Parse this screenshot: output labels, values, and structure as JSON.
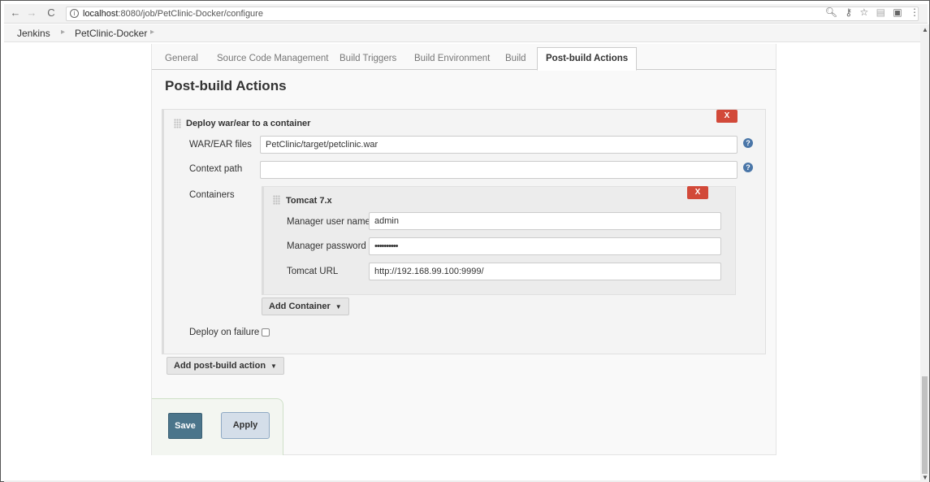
{
  "browser": {
    "back_glyph": "←",
    "forward_glyph": "→",
    "reload_glyph": "C",
    "url_host": "localhost",
    "url_rest": ":8080/job/PetClinic-Docker/configure",
    "toolbar_icons": [
      "zoom-icon",
      "key-icon",
      "star-icon",
      "pdf-icon",
      "extension-icon",
      "menu-icon"
    ]
  },
  "breadcrumb": {
    "items": [
      "Jenkins",
      "PetClinic-Docker"
    ]
  },
  "tabs": [
    {
      "label": "General"
    },
    {
      "label": "Source Code Management"
    },
    {
      "label": "Build Triggers"
    },
    {
      "label": "Build Environment"
    },
    {
      "label": "Build"
    },
    {
      "label": "Post-build Actions",
      "active": true
    }
  ],
  "section": {
    "title": "Post-build Actions"
  },
  "deploy": {
    "title": "Deploy war/ear to a container",
    "remove_label": "X",
    "war_label": "WAR/EAR files",
    "war_value": "PetClinic/target/petclinic.war",
    "context_label": "Context path",
    "context_value": "",
    "containers_label": "Containers",
    "help_glyph": "?",
    "tomcat": {
      "title": "Tomcat 7.x",
      "remove_label": "X",
      "user_label": "Manager user name",
      "user_value": "admin",
      "password_label": "Manager password",
      "password_value": "••••••••••",
      "url_label": "Tomcat URL",
      "url_value": "http://192.168.99.100:9999/"
    },
    "add_container_label": "Add Container",
    "deploy_on_failure_label": "Deploy on failure",
    "deploy_on_failure_checked": false
  },
  "add_post_build_label": "Add post-build action",
  "buttons": {
    "save": "Save",
    "apply": "Apply"
  },
  "colors": {
    "remove_button": "#d24939",
    "save_button": "#4b758b",
    "help_icon": "#4a76a8"
  }
}
